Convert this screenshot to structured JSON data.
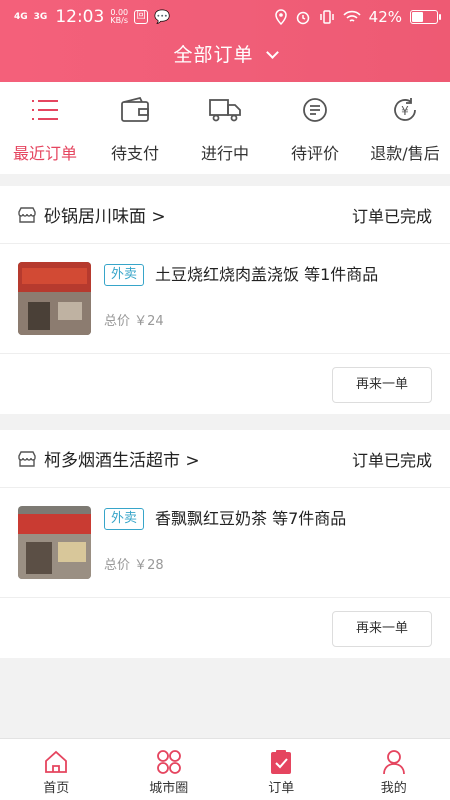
{
  "status_bar": {
    "signal1": "4G",
    "signal2": "3G",
    "time": "12:03",
    "speed_value": "0.00",
    "speed_unit": "KB/s",
    "battery": "42%",
    "battery_level": 0.42
  },
  "header": {
    "title": "全部订单"
  },
  "tabs": [
    {
      "label": "最近订单",
      "icon": "list-icon",
      "active": true
    },
    {
      "label": "待支付",
      "icon": "wallet-icon",
      "active": false
    },
    {
      "label": "进行中",
      "icon": "truck-icon",
      "active": false
    },
    {
      "label": "待评价",
      "icon": "review-icon",
      "active": false
    },
    {
      "label": "退款/售后",
      "icon": "refund-yen-icon",
      "active": false
    }
  ],
  "orders": [
    {
      "shop": "砂锅居川味面 >",
      "status": "订单已完成",
      "tag": "外卖",
      "title": "土豆烧红烧肉盖浇饭 等1件商品",
      "price": "总价 ￥24",
      "button": "再来一单"
    },
    {
      "shop": "柯多烟酒生活超市 >",
      "status": "订单已完成",
      "tag": "外卖",
      "title": "香飘飘红豆奶茶 等7件商品",
      "price": "总价 ￥28",
      "button": "再来一单"
    }
  ],
  "bottom_nav": [
    {
      "label": "首页",
      "icon": "home-icon"
    },
    {
      "label": "城市圈",
      "icon": "city-circle-icon"
    },
    {
      "label": "订单",
      "icon": "order-icon"
    },
    {
      "label": "我的",
      "icon": "profile-icon"
    }
  ],
  "colors": {
    "brand": "#f05e78",
    "active": "#e5455f",
    "tag": "#37a5c9"
  }
}
